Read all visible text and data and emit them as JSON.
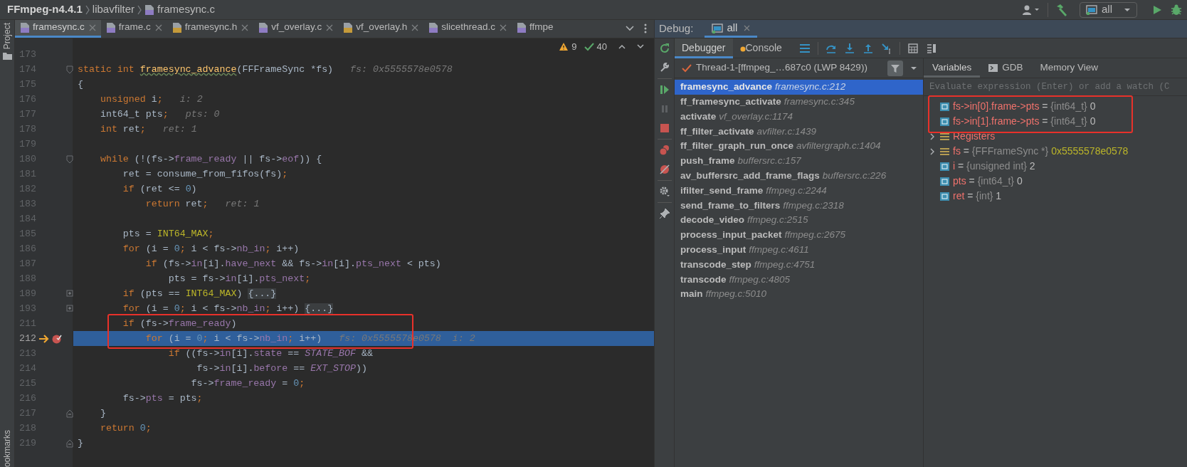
{
  "breadcrumb": [
    {
      "kind": "project",
      "text": "FFmpeg-n4.4.1"
    },
    {
      "kind": "folder",
      "text": "libavfilter"
    },
    {
      "kind": "file",
      "text": "framesync.c"
    }
  ],
  "toolbar": {
    "run_configuration": "all"
  },
  "side_strip": {
    "top": "Project",
    "bottom": "ookmarks"
  },
  "editor": {
    "tabs": [
      {
        "label": "framesync.c",
        "kind": "c",
        "selected": true
      },
      {
        "label": "frame.c",
        "kind": "c",
        "selected": false
      },
      {
        "label": "framesync.h",
        "kind": "h",
        "selected": false
      },
      {
        "label": "vf_overlay.c",
        "kind": "c",
        "selected": false
      },
      {
        "label": "vf_overlay.h",
        "kind": "h",
        "selected": false
      },
      {
        "label": "slicethread.c",
        "kind": "c",
        "selected": false
      },
      {
        "label": "ffmpe",
        "kind": "c",
        "selected": false
      }
    ],
    "inspections": {
      "warnings": "9",
      "passed": "40"
    },
    "lines": [
      {
        "number": "173"
      },
      {
        "number": "174",
        "foldable": true,
        "segments": [
          {
            "kind": "keyword",
            "text": "static int "
          },
          {
            "kind": "function",
            "text": "framesync_advance"
          },
          {
            "kind": "plain",
            "text": "(FFFrameSync *fs)"
          }
        ],
        "hints": [
          "fs: 0x5555578e0578"
        ]
      },
      {
        "number": "175",
        "segments": [
          {
            "kind": "plain",
            "text": "{"
          }
        ]
      },
      {
        "number": "176",
        "segments": [
          {
            "kind": "keyword",
            "text": "    unsigned"
          },
          {
            "kind": "plain",
            "text": " i"
          },
          {
            "kind": "punctuation",
            "text": ";"
          }
        ],
        "hints": [
          "i: 2"
        ]
      },
      {
        "number": "177",
        "segments": [
          {
            "kind": "plain",
            "text": "    int64_t pts"
          },
          {
            "kind": "punctuation",
            "text": ";"
          }
        ],
        "hints": [
          "pts: 0"
        ]
      },
      {
        "number": "178",
        "segments": [
          {
            "kind": "keyword",
            "text": "    int"
          },
          {
            "kind": "plain",
            "text": " ret"
          },
          {
            "kind": "punctuation",
            "text": ";"
          }
        ],
        "hints": [
          "ret: 1"
        ]
      },
      {
        "number": "179"
      },
      {
        "number": "180",
        "foldable": true,
        "segments": [
          {
            "kind": "keyword",
            "text": "    while"
          },
          {
            "kind": "plain",
            "text": " (!(fs->"
          },
          {
            "kind": "field",
            "text": "frame_ready"
          },
          {
            "kind": "plain",
            "text": " || fs->"
          },
          {
            "kind": "field",
            "text": "eof"
          },
          {
            "kind": "plain",
            "text": ")) {"
          }
        ]
      },
      {
        "number": "181",
        "segments": [
          {
            "kind": "plain",
            "text": "        ret = consume_from_fifos(fs)"
          },
          {
            "kind": "punctuation",
            "text": ";"
          }
        ]
      },
      {
        "number": "182",
        "segments": [
          {
            "kind": "keyword",
            "text": "        if"
          },
          {
            "kind": "plain",
            "text": " (ret <= "
          },
          {
            "kind": "number",
            "text": "0"
          },
          {
            "kind": "plain",
            "text": ")"
          }
        ]
      },
      {
        "number": "183",
        "segments": [
          {
            "kind": "keyword",
            "text": "            return"
          },
          {
            "kind": "plain",
            "text": " ret"
          },
          {
            "kind": "punctuation",
            "text": ";"
          }
        ],
        "hints": [
          "ret: 1"
        ]
      },
      {
        "number": "184"
      },
      {
        "number": "185",
        "segments": [
          {
            "kind": "plain",
            "text": "        pts = "
          },
          {
            "kind": "macro",
            "text": "INT64_MAX"
          },
          {
            "kind": "punctuation",
            "text": ";"
          }
        ]
      },
      {
        "number": "186",
        "segments": [
          {
            "kind": "keyword",
            "text": "        for"
          },
          {
            "kind": "plain",
            "text": " (i = "
          },
          {
            "kind": "number",
            "text": "0"
          },
          {
            "kind": "punctuation",
            "text": ";"
          },
          {
            "kind": "plain",
            "text": " i < fs->"
          },
          {
            "kind": "field",
            "text": "nb_in"
          },
          {
            "kind": "punctuation",
            "text": ";"
          },
          {
            "kind": "plain",
            "text": " i++)"
          }
        ]
      },
      {
        "number": "187",
        "segments": [
          {
            "kind": "keyword",
            "text": "            if"
          },
          {
            "kind": "plain",
            "text": " (fs->"
          },
          {
            "kind": "field",
            "text": "in"
          },
          {
            "kind": "plain",
            "text": "[i]."
          },
          {
            "kind": "field",
            "text": "have_next"
          },
          {
            "kind": "plain",
            "text": " && fs->"
          },
          {
            "kind": "field",
            "text": "in"
          },
          {
            "kind": "plain",
            "text": "[i]."
          },
          {
            "kind": "field",
            "text": "pts_next"
          },
          {
            "kind": "plain",
            "text": " < pts)"
          }
        ]
      },
      {
        "number": "188",
        "segments": [
          {
            "kind": "plain",
            "text": "                pts = fs->"
          },
          {
            "kind": "field",
            "text": "in"
          },
          {
            "kind": "plain",
            "text": "[i]."
          },
          {
            "kind": "field",
            "text": "pts_next"
          },
          {
            "kind": "punctuation",
            "text": ";"
          }
        ]
      },
      {
        "number": "189",
        "collapsed": true,
        "segments": [
          {
            "kind": "keyword",
            "text": "        if"
          },
          {
            "kind": "plain",
            "text": " (pts == "
          },
          {
            "kind": "macro",
            "text": "INT64_MAX"
          },
          {
            "kind": "plain",
            "text": ") "
          },
          {
            "kind": "folded",
            "text": "{...}"
          }
        ]
      },
      {
        "number": "193",
        "collapsed": true,
        "segments": [
          {
            "kind": "keyword",
            "text": "        for"
          },
          {
            "kind": "plain",
            "text": " (i = "
          },
          {
            "kind": "number",
            "text": "0"
          },
          {
            "kind": "punctuation",
            "text": ";"
          },
          {
            "kind": "plain",
            "text": " i < fs->"
          },
          {
            "kind": "field",
            "text": "nb_in"
          },
          {
            "kind": "punctuation",
            "text": ";"
          },
          {
            "kind": "plain",
            "text": " i++) "
          },
          {
            "kind": "folded",
            "text": "{...}"
          }
        ]
      },
      {
        "number": "211",
        "boxed": true,
        "segments": [
          {
            "kind": "keyword",
            "text": "        if"
          },
          {
            "kind": "plain",
            "text": " (fs->"
          },
          {
            "kind": "field",
            "text": "frame_ready"
          },
          {
            "kind": "plain",
            "text": ")"
          }
        ]
      },
      {
        "number": "212",
        "boxed": true,
        "current": true,
        "breakpoint": true,
        "segments": [
          {
            "kind": "keyword",
            "text": "            for"
          },
          {
            "kind": "plain",
            "text": " (i = "
          },
          {
            "kind": "number",
            "text": "0"
          },
          {
            "kind": "punctuation",
            "text": ";"
          },
          {
            "kind": "plain",
            "text": " i < fs->"
          },
          {
            "kind": "field",
            "text": "nb_in"
          },
          {
            "kind": "punctuation",
            "text": ";"
          },
          {
            "kind": "plain",
            "text": " i++)"
          }
        ],
        "hints": [
          "fs: 0x5555578e0578",
          "i: 2"
        ]
      },
      {
        "number": "213",
        "segments": [
          {
            "kind": "keyword",
            "text": "                if"
          },
          {
            "kind": "plain",
            "text": " ((fs->"
          },
          {
            "kind": "field",
            "text": "in"
          },
          {
            "kind": "plain",
            "text": "[i]."
          },
          {
            "kind": "field",
            "text": "state"
          },
          {
            "kind": "plain",
            "text": " == "
          },
          {
            "kind": "enum",
            "text": "STATE_BOF"
          },
          {
            "kind": "plain",
            "text": " &&"
          }
        ]
      },
      {
        "number": "214",
        "segments": [
          {
            "kind": "plain",
            "text": "                     fs->"
          },
          {
            "kind": "field",
            "text": "in"
          },
          {
            "kind": "plain",
            "text": "[i]."
          },
          {
            "kind": "field",
            "text": "before"
          },
          {
            "kind": "plain",
            "text": " == "
          },
          {
            "kind": "enum",
            "text": "EXT_STOP"
          },
          {
            "kind": "plain",
            "text": "))"
          }
        ]
      },
      {
        "number": "215",
        "segments": [
          {
            "kind": "plain",
            "text": "                    fs->"
          },
          {
            "kind": "field",
            "text": "frame_ready"
          },
          {
            "kind": "plain",
            "text": " = "
          },
          {
            "kind": "number",
            "text": "0"
          },
          {
            "kind": "punctuation",
            "text": ";"
          }
        ]
      },
      {
        "number": "216",
        "segments": [
          {
            "kind": "plain",
            "text": "        fs->"
          },
          {
            "kind": "field",
            "text": "pts"
          },
          {
            "kind": "plain",
            "text": " = pts"
          },
          {
            "kind": "punctuation",
            "text": ";"
          }
        ]
      },
      {
        "number": "217",
        "block_end": true,
        "segments": [
          {
            "kind": "plain",
            "text": "    }"
          }
        ]
      },
      {
        "number": "218",
        "segments": [
          {
            "kind": "keyword",
            "text": "    return"
          },
          {
            "kind": "number",
            "text": " 0"
          },
          {
            "kind": "punctuation",
            "text": ";"
          }
        ]
      },
      {
        "number": "219",
        "block_end": true,
        "segments": [
          {
            "kind": "plain",
            "text": "}"
          }
        ]
      }
    ]
  },
  "debug": {
    "title": "Debug:",
    "session_tab": "all",
    "tabs": [
      {
        "label": "Debugger",
        "selected": true
      },
      {
        "label": "Console",
        "selected": false
      }
    ],
    "thread": "Thread-1-[ffmpeg_…687c0 (LWP 8429))",
    "frames": [
      {
        "function": "framesync_advance",
        "location": "framesync.c:212",
        "selected": true
      },
      {
        "function": "ff_framesync_activate",
        "location": "framesync.c:345",
        "selected": false
      },
      {
        "function": "activate",
        "location": "vf_overlay.c:1174",
        "selected": false
      },
      {
        "function": "ff_filter_activate",
        "location": "avfilter.c:1439",
        "selected": false
      },
      {
        "function": "ff_filter_graph_run_once",
        "location": "avfiltergraph.c:1404",
        "selected": false
      },
      {
        "function": "push_frame",
        "location": "buffersrc.c:157",
        "selected": false
      },
      {
        "function": "av_buffersrc_add_frame_flags",
        "location": "buffersrc.c:226",
        "selected": false
      },
      {
        "function": "ifilter_send_frame",
        "location": "ffmpeg.c:2244",
        "selected": false
      },
      {
        "function": "send_frame_to_filters",
        "location": "ffmpeg.c:2318",
        "selected": false
      },
      {
        "function": "decode_video",
        "location": "ffmpeg.c:2515",
        "selected": false
      },
      {
        "function": "process_input_packet",
        "location": "ffmpeg.c:2675",
        "selected": false
      },
      {
        "function": "process_input",
        "location": "ffmpeg.c:4611",
        "selected": false
      },
      {
        "function": "transcode_step",
        "location": "ffmpeg.c:4751",
        "selected": false
      },
      {
        "function": "transcode",
        "location": "ffmpeg.c:4805",
        "selected": false
      },
      {
        "function": "main",
        "location": "ffmpeg.c:5010",
        "selected": false
      }
    ],
    "variable_tabs": [
      {
        "label": "Variables",
        "kind": "variables",
        "selected": true
      },
      {
        "label": "GDB",
        "kind": "console",
        "selected": false
      },
      {
        "label": "Memory View",
        "kind": "memory",
        "selected": false
      }
    ],
    "evaluate_placeholder": "Evaluate expression (Enter) or add a watch (C",
    "variables": [
      {
        "kind": "watch",
        "name": "fs->in[0].frame->pts",
        "operator": "=",
        "type": "{int64_t}",
        "value": "0",
        "boxed": true
      },
      {
        "kind": "watch",
        "name": "fs->in[1].frame->pts",
        "operator": "=",
        "type": "{int64_t}",
        "value": "0",
        "boxed": true
      },
      {
        "kind": "group",
        "name": "Registers"
      },
      {
        "kind": "pointer",
        "name": "fs",
        "operator": "=",
        "type": "{FFFrameSync *}",
        "value": "0x5555578e0578"
      },
      {
        "kind": "value",
        "name": "i",
        "operator": "=",
        "type": "{unsigned int}",
        "value": "2"
      },
      {
        "kind": "value",
        "name": "pts",
        "operator": "=",
        "type": "{int64_t}",
        "value": "0"
      },
      {
        "kind": "value",
        "name": "ret",
        "operator": "=",
        "type": "{int}",
        "value": "1"
      }
    ]
  }
}
